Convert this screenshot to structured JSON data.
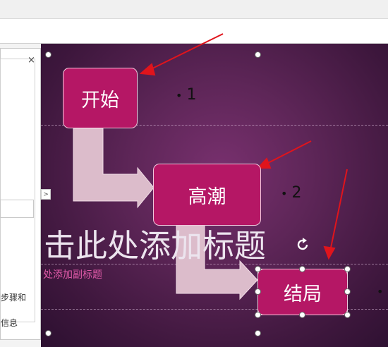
{
  "panel": {
    "close_glyph": "×",
    "text_line1": "步骤和",
    "text_line2": "信息",
    "expand_glyph": ">"
  },
  "diagram": {
    "nodes": [
      {
        "label": "开始"
      },
      {
        "label": "高潮"
      },
      {
        "label": "结局"
      }
    ],
    "bullets": [
      {
        "marker": "•",
        "text": "1"
      },
      {
        "marker": "•",
        "text": "2"
      },
      {
        "marker": "•",
        "text": ""
      }
    ]
  },
  "placeholders": {
    "title": "击此处添加标题",
    "subtitle": "处添加副标题"
  },
  "colors": {
    "node_fill": "#b51765",
    "arrow_fill": "#dcbccb",
    "annotation_arrow": "#e0141c",
    "background": "#5e2658"
  },
  "icons": {
    "rotate": "rotate-handle-icon",
    "close": "close-icon",
    "expand": "chevron-right-icon"
  }
}
